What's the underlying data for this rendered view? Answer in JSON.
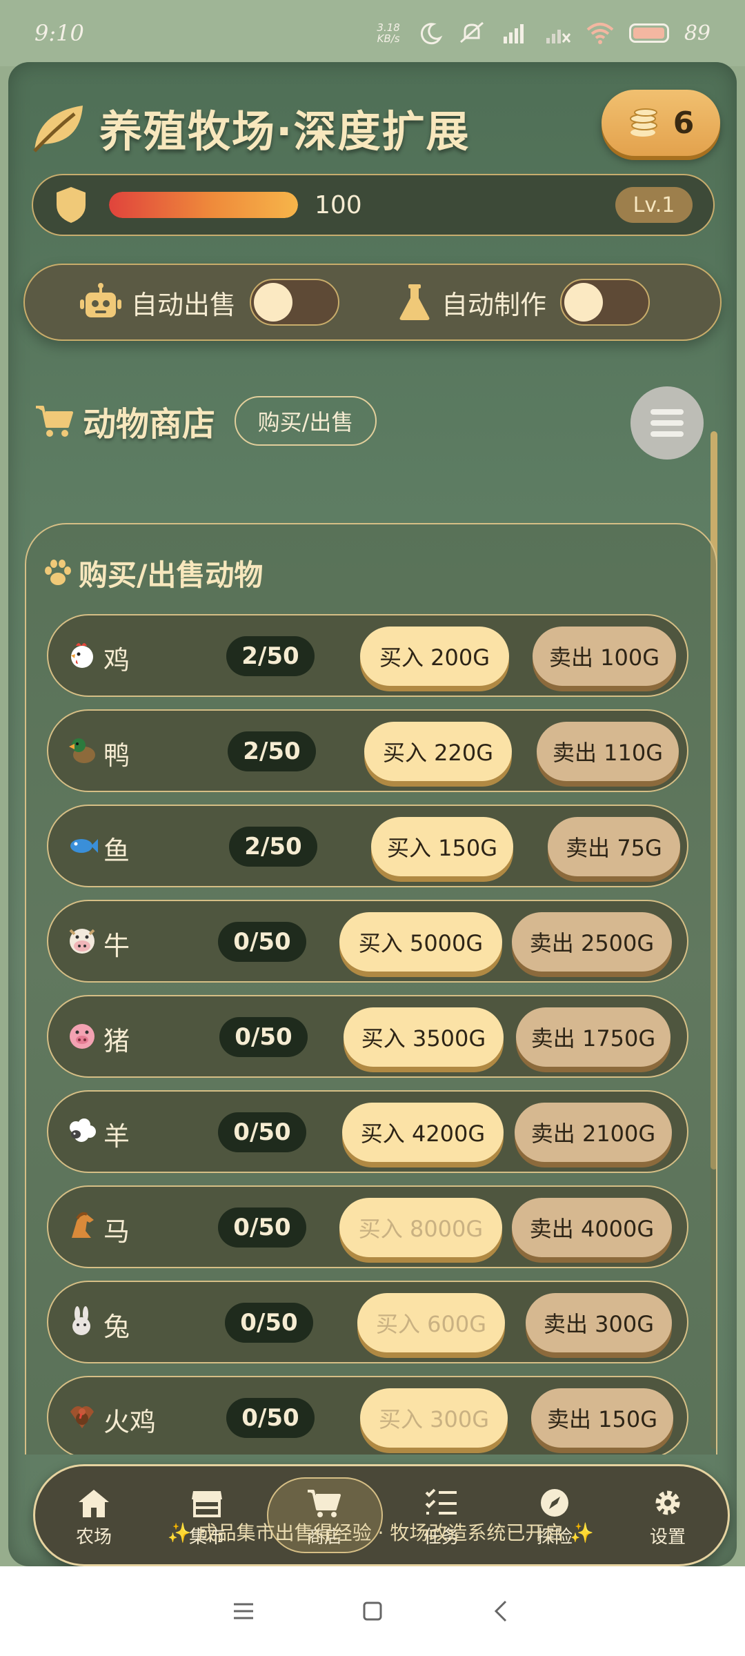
{
  "status_bar": {
    "time": "9:10",
    "net_speed_value": "3.18",
    "net_speed_unit": "KB/s",
    "battery": "89"
  },
  "header": {
    "title": "养殖牧场·深度扩展",
    "coins": "6"
  },
  "hp": {
    "value": "100",
    "fill_fraction": 1.0,
    "level": "Lv.1"
  },
  "toggles": {
    "auto_sell_label": "自动出售",
    "auto_craft_label": "自动制作"
  },
  "shop": {
    "title": "动物商店",
    "tab_label": "购买/出售",
    "list_title": "购买/出售动物",
    "animals": [
      {
        "icon": "chicken-icon",
        "name": "鸡",
        "count": "2/50",
        "buy": "买入 200G",
        "sell": "卖出 100G",
        "buy_enabled": true
      },
      {
        "icon": "duck-icon",
        "name": "鸭",
        "count": "2/50",
        "buy": "买入 220G",
        "sell": "卖出 110G",
        "buy_enabled": true
      },
      {
        "icon": "fish-icon",
        "name": "鱼",
        "count": "2/50",
        "buy": "买入 150G",
        "sell": "卖出 75G",
        "buy_enabled": true
      },
      {
        "icon": "cow-icon",
        "name": "牛",
        "count": "0/50",
        "buy": "买入 5000G",
        "sell": "卖出 2500G",
        "buy_enabled": true
      },
      {
        "icon": "pig-icon",
        "name": "猪",
        "count": "0/50",
        "buy": "买入 3500G",
        "sell": "卖出 1750G",
        "buy_enabled": true
      },
      {
        "icon": "sheep-icon",
        "name": "羊",
        "count": "0/50",
        "buy": "买入 4200G",
        "sell": "卖出 2100G",
        "buy_enabled": true
      },
      {
        "icon": "horse-icon",
        "name": "马",
        "count": "0/50",
        "buy": "买入 8000G",
        "sell": "卖出 4000G",
        "buy_enabled": false
      },
      {
        "icon": "rabbit-icon",
        "name": "兔",
        "count": "0/50",
        "buy": "买入 600G",
        "sell": "卖出 300G",
        "buy_enabled": false
      },
      {
        "icon": "turkey-icon",
        "name": "火鸡",
        "count": "0/50",
        "buy": "买入 300G",
        "sell": "卖出 150G",
        "buy_enabled": false
      }
    ]
  },
  "nav": {
    "items": [
      {
        "label": "农场",
        "icon": "home-icon"
      },
      {
        "label": "集市",
        "icon": "market-icon"
      },
      {
        "label": "商店",
        "icon": "cart-icon"
      },
      {
        "label": "任务",
        "icon": "tasks-icon"
      },
      {
        "label": "探险",
        "icon": "compass-icon"
      },
      {
        "label": "设置",
        "icon": "gear-icon"
      }
    ],
    "active_index": 2
  },
  "footer_note": "✨ 成品集市出售得经验 · 牧场改造系统已开启 ✨",
  "colors": {
    "accent_gold": "#c9ad6b",
    "buy_button": "#fbe2a6",
    "sell_button": "#d6b890",
    "hp_red": "#e0443c",
    "hp_orange": "#f6b54a"
  }
}
